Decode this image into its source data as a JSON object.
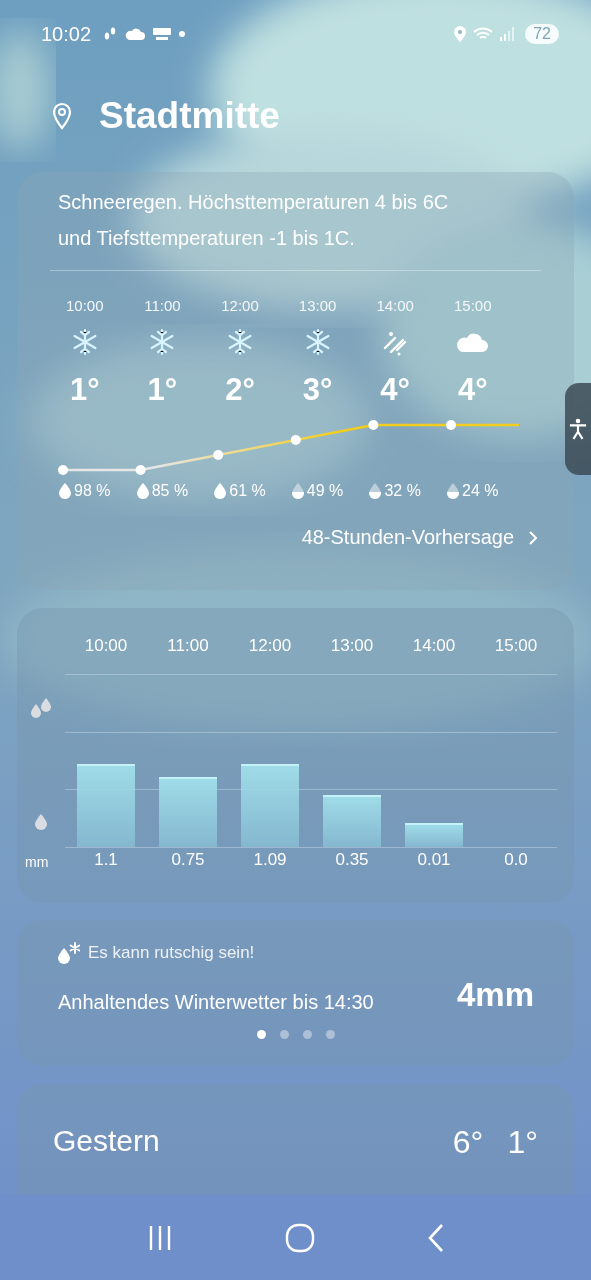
{
  "status_bar": {
    "time": "10:02",
    "battery": "72"
  },
  "location": {
    "name": "Stadtmitte"
  },
  "hourly": {
    "summary": "Schneeregen. Höchsttemperaturen 4 bis 6C und Tiefsttemperaturen -1 bis 1C.",
    "hours": [
      {
        "time": "10:00",
        "kind": "snow",
        "temp": "1°",
        "drop_full": true,
        "humidity": "98 %"
      },
      {
        "time": "11:00",
        "kind": "snow",
        "temp": "1°",
        "drop_full": true,
        "humidity": "85 %"
      },
      {
        "time": "12:00",
        "kind": "snow",
        "temp": "2°",
        "drop_full": true,
        "humidity": "61 %"
      },
      {
        "time": "13:00",
        "kind": "snow",
        "temp": "3°",
        "drop_full": false,
        "humidity": "49 %"
      },
      {
        "time": "14:00",
        "kind": "sleet",
        "temp": "4°",
        "drop_full": false,
        "humidity": "32 %"
      },
      {
        "time": "15:00",
        "kind": "cloud",
        "temp": "4°",
        "drop_full": false,
        "humidity": "24 %"
      }
    ],
    "forecast_link": "48-Stunden-Vorhersage"
  },
  "precipitation": {
    "unit": "mm",
    "hours": [
      {
        "time": "10:00",
        "amount": "1.1"
      },
      {
        "time": "11:00",
        "amount": "0.75"
      },
      {
        "time": "12:00",
        "amount": "1.09"
      },
      {
        "time": "13:00",
        "amount": "0.35"
      },
      {
        "time": "14:00",
        "amount": "0.01"
      },
      {
        "time": "15:00",
        "amount": "0.0"
      }
    ]
  },
  "alert": {
    "title": "Es kann rutschig sein!",
    "message": "Anhaltendes Winterwetter bis 14:30",
    "amount": "4mm",
    "pages": [
      {
        "selected": true
      },
      {
        "selected": false
      },
      {
        "selected": false
      },
      {
        "selected": false
      }
    ]
  },
  "yesterday": {
    "label": "Gestern",
    "high": "6°",
    "low": "1°"
  }
}
